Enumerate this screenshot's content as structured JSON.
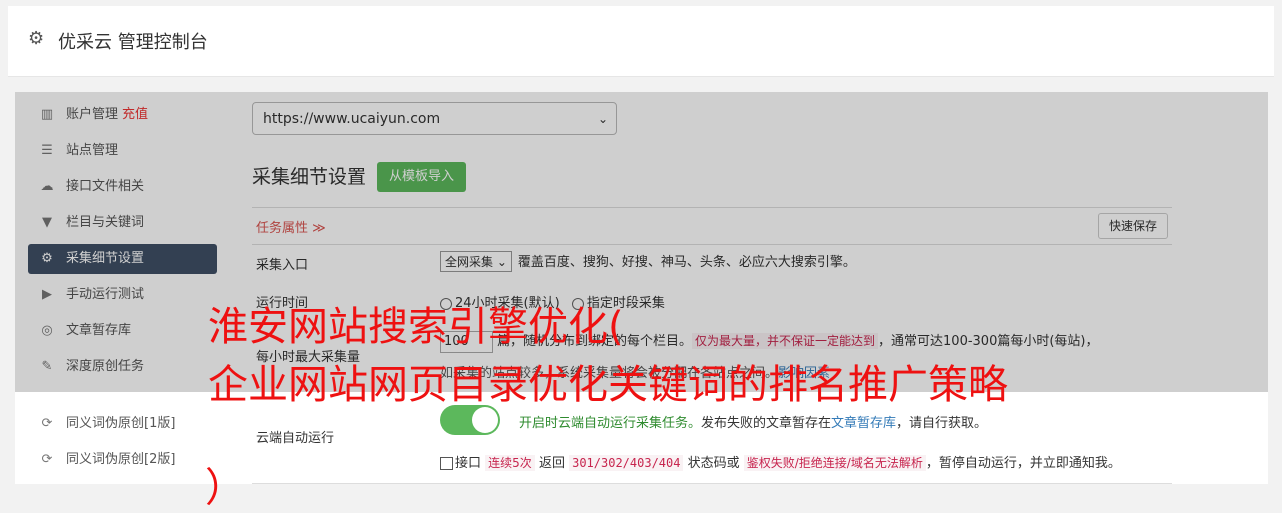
{
  "header": {
    "title": "优采云 管理控制台"
  },
  "sidebar": {
    "items": [
      {
        "label": "账户管理",
        "tag": "充值",
        "icon": "bar-chart-icon"
      },
      {
        "label": "站点管理",
        "icon": "server-icon"
      },
      {
        "label": "接口文件相关",
        "icon": "cloud-upload-icon"
      },
      {
        "label": "栏目与关键词",
        "icon": "filter-icon"
      },
      {
        "label": "采集细节设置",
        "icon": "gears-icon",
        "active": true
      },
      {
        "label": "手动运行测试",
        "icon": "play-circle-icon"
      },
      {
        "label": "文章暂存库",
        "icon": "database-icon"
      },
      {
        "label": "深度原创任务",
        "icon": "edit-icon"
      },
      {
        "label": "同义词伪原创[1版]",
        "icon": "refresh-icon"
      },
      {
        "label": "同义词伪原创[2版]",
        "icon": "refresh-icon"
      }
    ]
  },
  "main": {
    "site_url": "https://www.ucaiyun.com",
    "section_title": "采集细节设置",
    "import_button": "从模板导入",
    "task_props_label": "任务属性 ≫",
    "quick_save_button": "快速保存",
    "collect_entry": {
      "label": "采集入口",
      "select_value": "全网采集",
      "desc": "覆盖百度、搜狗、好搜、神马、头条、必应六大搜索引擎。"
    },
    "run_time": {
      "label": "运行时间",
      "option1": "24小时采集(默认)",
      "option2": "指定时段采集"
    },
    "hourly_max": {
      "label": "每小时最大采集量",
      "value": "100",
      "text1": "篇，随机分布到绑定的每个栏目。",
      "highlight": "仅为最大量，并不保证一定能达到",
      "text2": "，通常可达100-300篇每小时(每站)，",
      "line2": "如采集的站点较多，系统采集量将会被分配在各站点之间。",
      "link": "影响因素"
    },
    "cloud_auto": {
      "label": "云端自动运行",
      "on_text": "开启时云端自动运行采集任务。",
      "text_a": "发布失败的文章暂存在",
      "link": "文章暂存库",
      "text_b": "，请自行获取。",
      "check_label": "接口",
      "hl1": "连续5次",
      "t1": "返回",
      "hl2": "301/302/403/404",
      "t2": "状态码或",
      "hl3": "鉴权失败/拒绝连接/域名无法解析",
      "t3": "，暂停自动运行，并立即通知我。"
    }
  },
  "watermark": {
    "line1": "淮安网站搜索引擎优化(",
    "line2": "企业网站网页目录优化关键词的排名推广策略",
    "line3": "）"
  }
}
